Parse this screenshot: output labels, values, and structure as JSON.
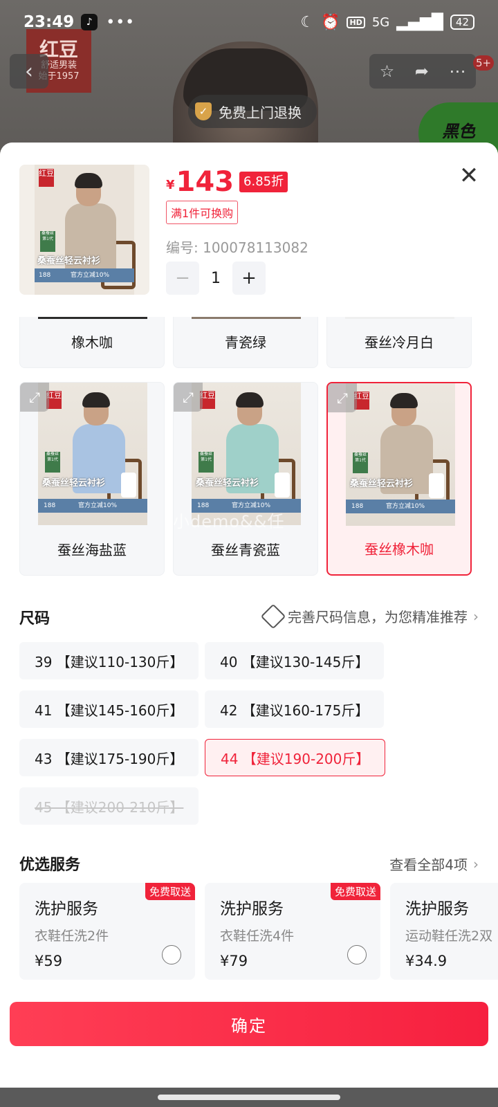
{
  "status_bar": {
    "time": "23:49",
    "more": "•••",
    "network": "5G",
    "hd": "HD",
    "battery": "42"
  },
  "background": {
    "brand_logo_big": "红豆",
    "brand_logo_small_1": "舒适男装",
    "brand_logo_small_2": "始于1957",
    "free_return": "免费上门退换",
    "badge_count": "5+",
    "green_tag": "黑色"
  },
  "product": {
    "currency": "¥",
    "price": "143",
    "discount": "6.85折",
    "promo": "满1件可换购",
    "sku_label": "编号: 100078113082",
    "quantity": "1",
    "minus": "−",
    "plus": "+"
  },
  "poster": {
    "logo": "红豆",
    "green_tag": "桑蚕丝 第1代",
    "title": "桑蚕丝轻云衬衫",
    "price": "188",
    "strip_text": "官方立减10%"
  },
  "colors": [
    {
      "label": "橡木咖",
      "selected": false
    },
    {
      "label": "青瓷绿",
      "selected": false
    },
    {
      "label": "蚕丝冷月白",
      "selected": false
    },
    {
      "label": "蚕丝海盐蓝",
      "selected": false
    },
    {
      "label": "蚕丝青瓷蓝",
      "selected": false
    },
    {
      "label": "蚕丝橡木咖",
      "selected": true
    }
  ],
  "size_section": {
    "title": "尺码",
    "hint": "完善尺码信息，为您精准推荐",
    "sizes": [
      {
        "label": "39 【建议110-130斤】",
        "state": "normal"
      },
      {
        "label": "40 【建议130-145斤】",
        "state": "normal"
      },
      {
        "label": "41 【建议145-160斤】",
        "state": "normal"
      },
      {
        "label": "42 【建议160-175斤】",
        "state": "normal"
      },
      {
        "label": "43 【建议175-190斤】",
        "state": "normal"
      },
      {
        "label": "44 【建议190-200斤】",
        "state": "selected"
      },
      {
        "label": "45 【建议200-210斤】",
        "state": "disabled"
      }
    ]
  },
  "service_section": {
    "title": "优选服务",
    "view_all": "查看全部4项",
    "items": [
      {
        "name": "洗护服务",
        "desc": "衣鞋任洗2件",
        "price": "¥59",
        "badge": "免费取送"
      },
      {
        "name": "洗护服务",
        "desc": "衣鞋任洗4件",
        "price": "¥79",
        "badge": "免费取送"
      },
      {
        "name": "洗护服务",
        "desc": "运动鞋任洗2双",
        "price": "¥34.9",
        "badge": ""
      }
    ]
  },
  "watermark": "小demo&&任",
  "confirm_label": "确定",
  "colors_theme": {
    "accent": "#f0233a",
    "chip_bg": "#f6f7f9"
  }
}
